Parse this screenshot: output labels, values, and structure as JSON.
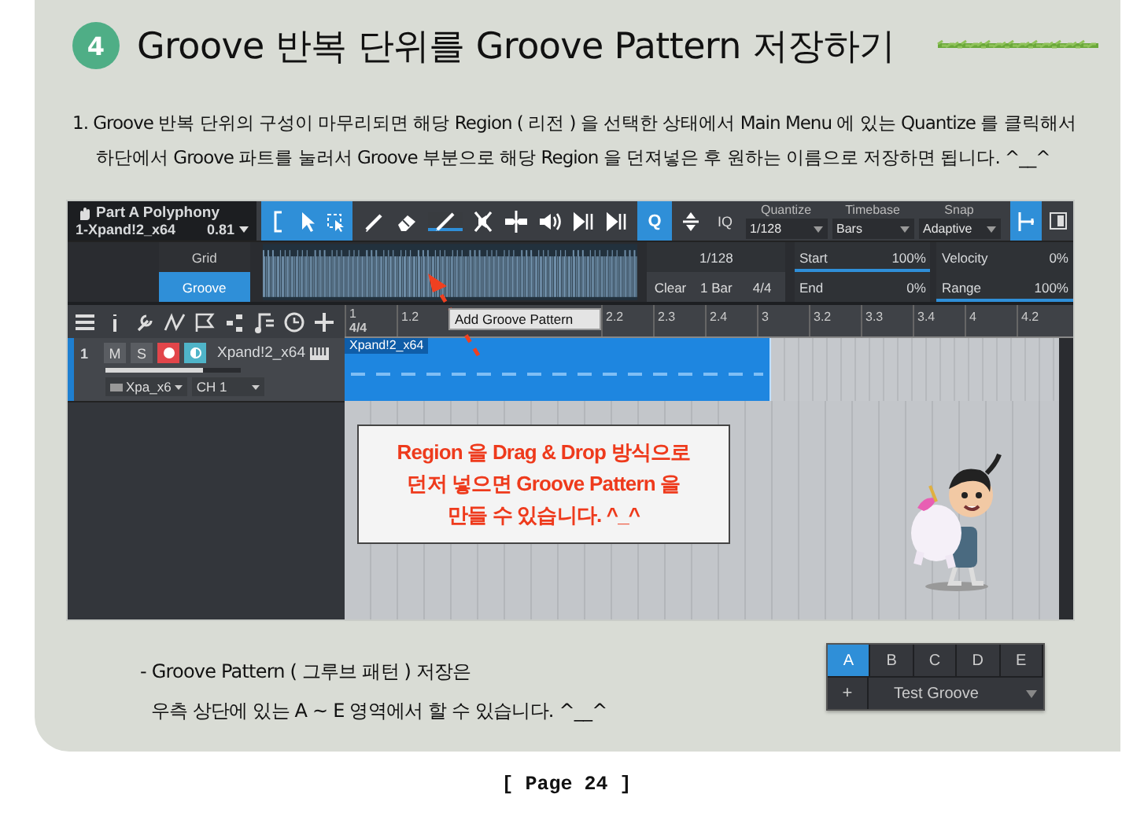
{
  "step": {
    "number": "4",
    "title": "Groove 반복 단위를 Groove Pattern 저장하기"
  },
  "instruction": {
    "lines": [
      "1. Groove 반복 단위의 구성이 마무리되면 해당 Region ( 리전 ) 을 선택한 상태에서 Main Menu 에 있는 Quantize 를 클릭해서",
      "하단에서 Groove 파트를 눌러서 Groove 부분으로 해당 Region 을 던져넣은 후 원하는 이름으로 저장하면 됩니다. ^__^"
    ]
  },
  "daw": {
    "track_info": {
      "title": "Part A Polyphony",
      "instrument": "1-Xpand!2_x64",
      "value": "0.81"
    },
    "quantize_button": {
      "label": "Q",
      "on": true
    },
    "iq_label": "IQ",
    "dropdowns": [
      {
        "label": "Quantize",
        "value": "1/128"
      },
      {
        "label": "Timebase",
        "value": "Bars"
      },
      {
        "label": "Snap",
        "value": "Adaptive"
      }
    ],
    "snap_toggle": {
      "on": true
    },
    "groove_tabs": [
      {
        "label": "Grid",
        "selected": false
      },
      {
        "label": "Groove",
        "selected": true
      }
    ],
    "resolution": "1/128",
    "groove_buttons": [
      "Clear",
      "1 Bar",
      "4/4"
    ],
    "params": [
      {
        "name": "Start",
        "reading": "100%",
        "level": 1
      },
      {
        "name": "End",
        "reading": "0%",
        "level": 0
      },
      {
        "name": "Velocity",
        "reading": "0%",
        "level": 0
      },
      {
        "name": "Range",
        "reading": "100%",
        "level": 1
      }
    ],
    "ruler": {
      "before_tooltip": [
        "1",
        "1.2"
      ],
      "tooltip": "Add Groove Pattern",
      "after_tooltip": [
        "2.2",
        "2.3",
        "2.4",
        "3",
        "3.2",
        "3.3",
        "3.4",
        "4",
        "4.2"
      ],
      "time_signature": "4/4"
    },
    "track": {
      "number": "1",
      "mute": "M",
      "solo": "S",
      "record": true,
      "monitor": true,
      "name": "Xpand!2_x64",
      "volume": {
        "level": 0.72
      },
      "instrument": "Xpa_x6",
      "channel": "CH 1"
    },
    "region": {
      "name": "Xpand!2_x64"
    },
    "callout": "Region 을 Drag & Drop 방식으로 던저 넣으면 Groove Pattern 을 만들 수 있습니다. ^_^"
  },
  "note": {
    "lines": [
      "- Groove Pattern ( 그루브 패턴 ) 저장은",
      "우측 상단에 있는 A ~ E 영역에서 할 수 있습니다. ^__^"
    ]
  },
  "pattern_panel": {
    "slots": [
      {
        "label": "A",
        "selected": true
      },
      {
        "label": "B",
        "selected": false
      },
      {
        "label": "C",
        "selected": false
      },
      {
        "label": "D",
        "selected": false
      },
      {
        "label": "E",
        "selected": false
      }
    ],
    "add": "+",
    "name": "Test Groove"
  },
  "footer": "[ Page 24 ]"
}
